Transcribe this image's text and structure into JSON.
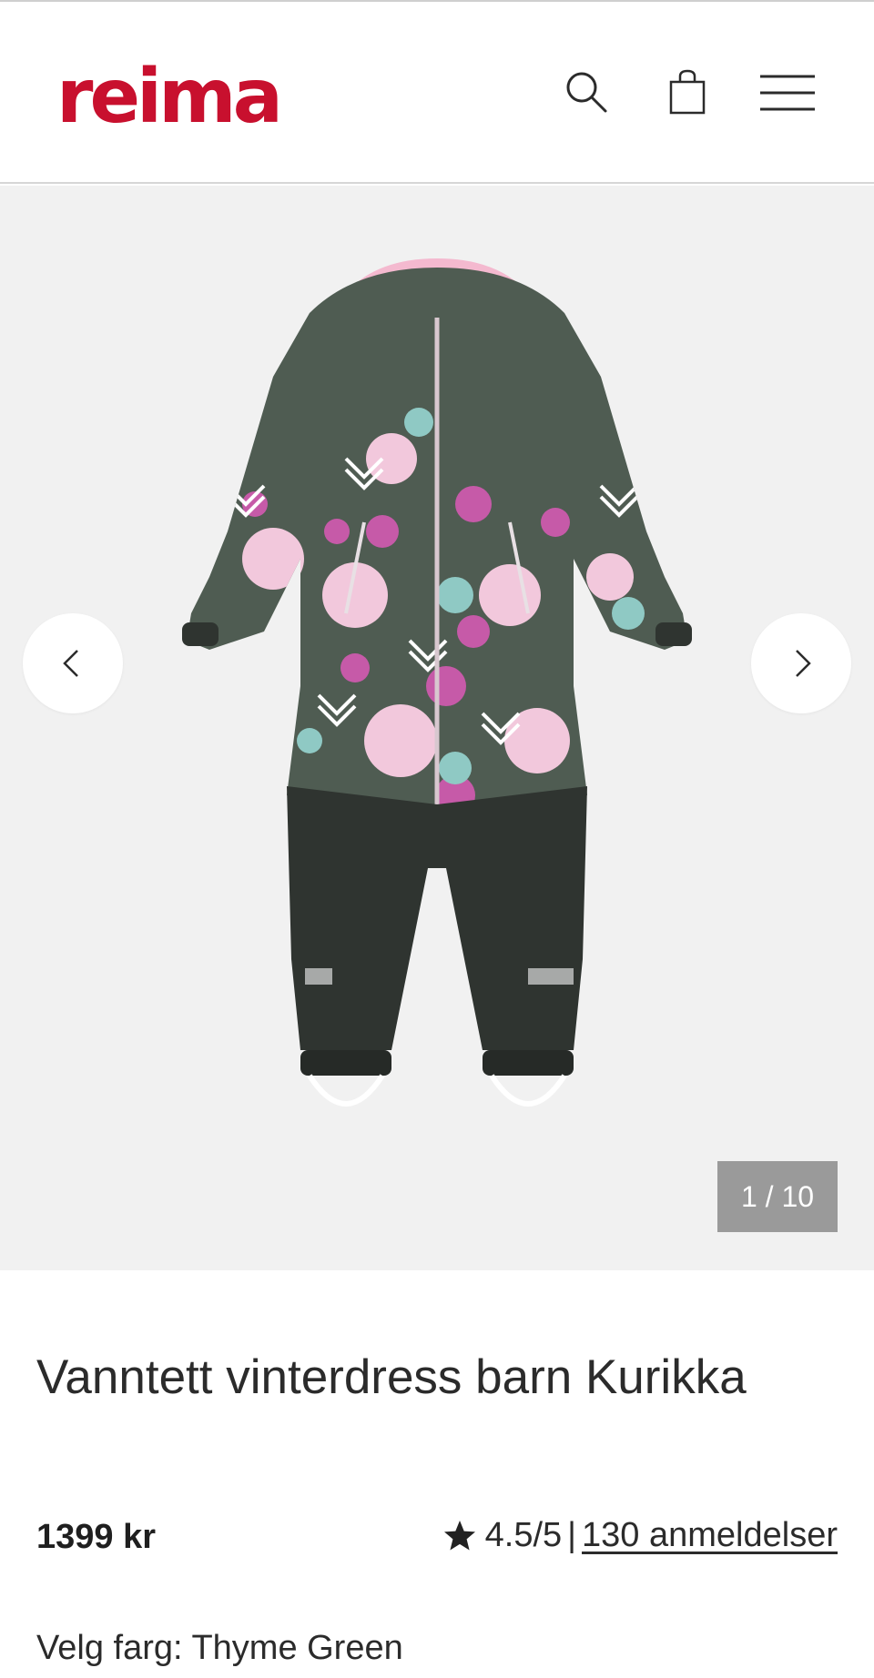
{
  "header": {
    "logo_text": "reima",
    "brand_color": "#c8102e",
    "icons": [
      "search-icon",
      "shopping-bag-icon",
      "menu-icon"
    ]
  },
  "gallery": {
    "counter": "1 / 10",
    "current_index": 1,
    "total": 10,
    "prev_icon": "chevron-left-icon",
    "next_icon": "chevron-right-icon"
  },
  "product": {
    "title": "Vanntett vinterdress barn Kurikka",
    "price": "1399 kr",
    "rating": "4.5/5",
    "rating_separator": "|",
    "reviews_link": "130 anmeldelser",
    "color_label": "Velg farg:",
    "color_value": "Thyme Green",
    "colors": {
      "base": "#4f5c52",
      "pink": "#e6a9c8",
      "lining": "#f4b9cf",
      "pants": "#2f3430"
    }
  }
}
